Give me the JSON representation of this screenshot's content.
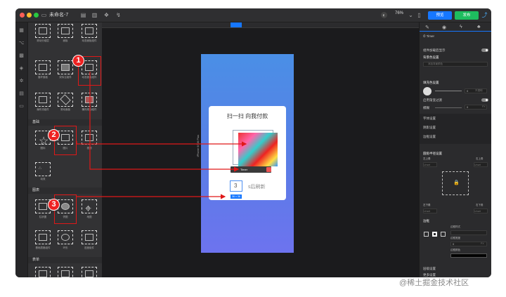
{
  "window": {
    "title": "未命名-7",
    "zoom": "76%",
    "preview_label": "预览",
    "publish_label": "发布"
  },
  "library": {
    "row1": [
      "滚动分组层",
      "面板",
      "动态面板组件"
    ],
    "row2": [
      "循环面板",
      "双标注组件",
      "动态面板组件"
    ],
    "row3": [
      "瀑布流组件",
      "滚动面板",
      "横向滚动组件"
    ],
    "section_media": "基础",
    "media": [
      "图标",
      "图片",
      "视频"
    ],
    "media2": [
      "动效"
    ],
    "section_chart": "图表",
    "chart": [
      "柱状图",
      "饼图",
      "地图"
    ],
    "chart2": [
      "基础表格组件",
      "环形",
      "进度组件"
    ],
    "section_form": "表单"
  },
  "badges": [
    "1",
    "2",
    "3"
  ],
  "canvas": {
    "card_title": "扫一扫 向我付款",
    "side_label": "iPhone 6/7/8 Plus",
    "countdown": "3",
    "refresh_text": "s后刷新",
    "size_tag": "36 × 36",
    "toolbar_timer": "Timer"
  },
  "panel": {
    "tabs": [
      "style",
      "interaction",
      "action",
      "component"
    ],
    "component_name": "Timer",
    "show_when_loaded": "组件加载后显示",
    "bg_color_title": "背景色设置",
    "bg_color_placeholder": "添加背景颜色",
    "fill_title": "填充色设置",
    "opacity_value": "0",
    "opacity_unit": "不透明",
    "gradient_label": "启用渐变过渡",
    "blur_label": "模糊",
    "blur_value": "0",
    "blur_unit": "PX",
    "font_settings": "字体设置",
    "shadow_settings": "阴影设置",
    "border_settings": "边框设置",
    "corner_title": "圆角半径设置",
    "tl": "左上角",
    "tr": "右上角",
    "bl": "左下角",
    "br": "右下角",
    "unit": "Unset",
    "border_title": "边框",
    "border_style": "边框样式",
    "border_width": "边框宽度",
    "border_width_value": "0",
    "border_width_unit": "PX",
    "border_color": "边框颜色",
    "layer_settings": "层级设置",
    "more_settings": "更多设置"
  },
  "colors": {
    "accent": "#1677ff",
    "publish": "#1ebd5f",
    "badge": "#e22222",
    "phone_top": "#4a8fe6",
    "phone_bottom": "#6d73ef"
  },
  "watermark": "@稀土掘金技术社区"
}
